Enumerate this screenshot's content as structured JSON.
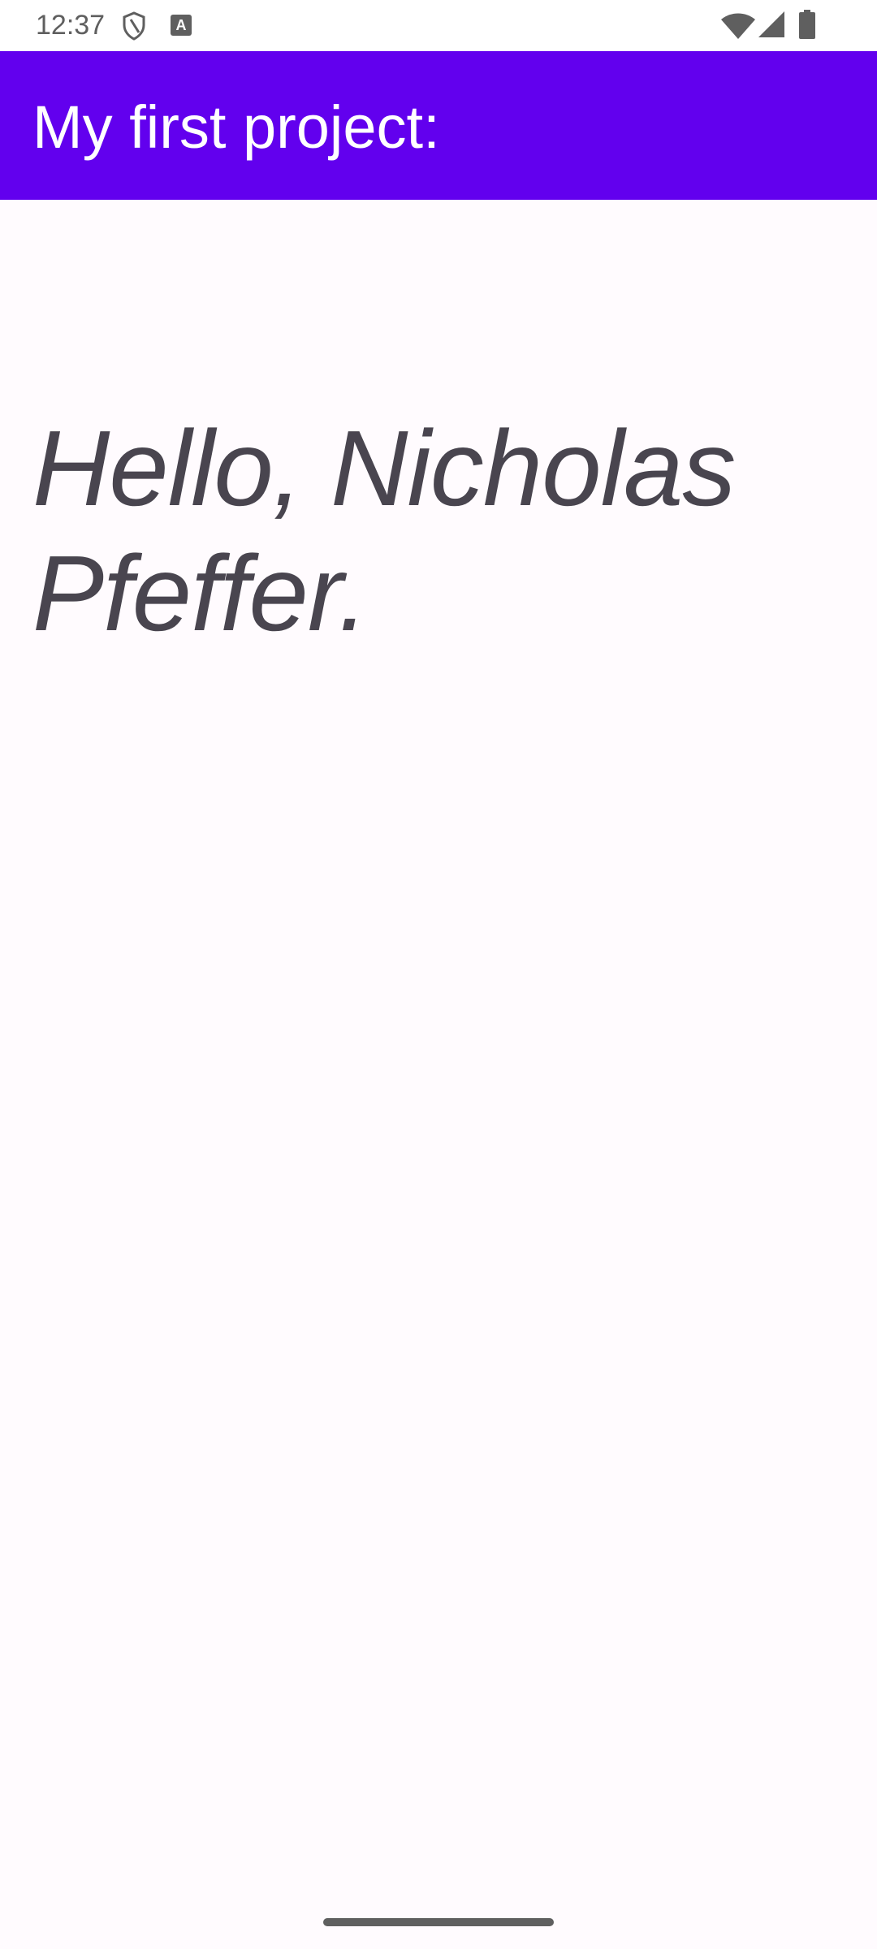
{
  "status_bar": {
    "time": "12:37",
    "icons": [
      "shield-icon",
      "font-a-icon",
      "wifi-icon",
      "signal-icon",
      "battery-icon"
    ],
    "a_icon_label": "A"
  },
  "app_bar": {
    "title": "My first project:",
    "background_color": "#6200EE"
  },
  "content": {
    "greeting": "Hello, Nicholas Pfeffer."
  },
  "colors": {
    "background": "#FFFBFE",
    "text": "#49454F",
    "status_icons": "#5F5F5F"
  }
}
